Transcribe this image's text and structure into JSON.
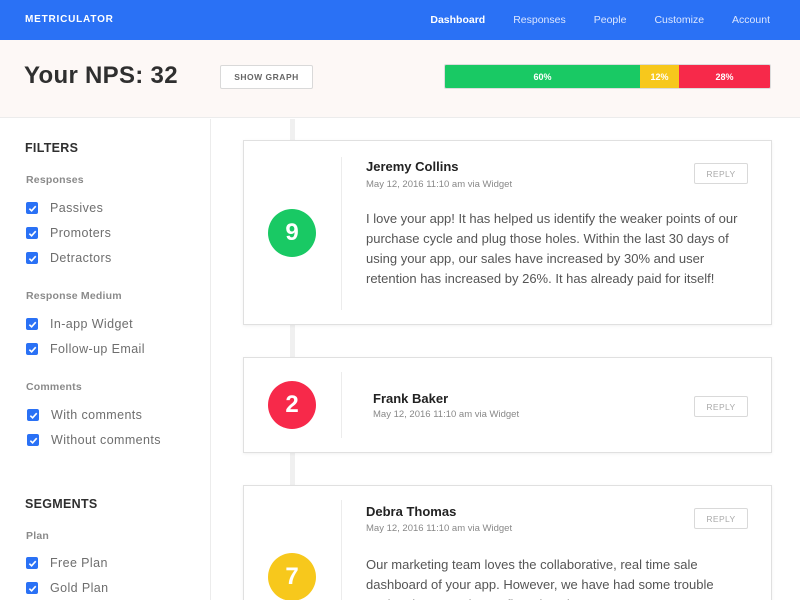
{
  "app": {
    "brand": "METRICULATOR"
  },
  "nav": {
    "items": [
      {
        "label": "Dashboard",
        "active": true
      },
      {
        "label": "Responses",
        "active": false
      },
      {
        "label": "People",
        "active": false
      },
      {
        "label": "Customize",
        "active": false
      },
      {
        "label": "Account",
        "active": false
      }
    ]
  },
  "header": {
    "title": "Your NPS: 32",
    "show_graph_label": "SHOW GRAPH",
    "breakdown": [
      {
        "label": "60%",
        "value": 60,
        "color": "#19c964"
      },
      {
        "label": "12%",
        "value": 12,
        "color": "#f7c81c"
      },
      {
        "label": "28%",
        "value": 28,
        "color": "#f7294a"
      }
    ]
  },
  "sidebar": {
    "filters_title": "FILTERS",
    "groups": [
      {
        "title": "Responses",
        "options": [
          {
            "label": "Passives",
            "checked": true
          },
          {
            "label": "Promoters",
            "checked": true
          },
          {
            "label": "Detractors",
            "checked": true
          }
        ]
      },
      {
        "title": "Response Medium",
        "options": [
          {
            "label": "In-app Widget",
            "checked": true
          },
          {
            "label": "Follow-up Email",
            "checked": true
          }
        ]
      },
      {
        "title": "Comments",
        "options": [
          {
            "label": "With comments",
            "checked": true
          },
          {
            "label": "Without comments",
            "checked": true
          }
        ]
      }
    ],
    "segments_title": "SEGMENTS",
    "segment_groups": [
      {
        "title": "Plan",
        "options": [
          {
            "label": "Free Plan",
            "checked": true
          },
          {
            "label": "Gold Plan",
            "checked": true
          }
        ]
      }
    ]
  },
  "responses": [
    {
      "score": "9",
      "color": "#19c964",
      "name": "Jeremy Collins",
      "meta": "May 12, 2016 11:10 am via Widget",
      "reply_label": "REPLY",
      "comment": "I love your app! It has helped us identify the weaker points of our purchase cycle and plug those holes. Within the last 30 days of using your app, our sales have increased by 30% and user retention has increased by 26%. It has already paid for itself!"
    },
    {
      "score": "2",
      "color": "#f7294a",
      "name": "Frank Baker",
      "meta": "May 12, 2016 11:10 am via Widget",
      "reply_label": "REPLY",
      "comment": ""
    },
    {
      "score": "7",
      "color": "#f7c81c",
      "name": "Debra Thomas",
      "meta": "May 12, 2016 11:10 am via Widget",
      "reply_label": "REPLY",
      "comment": "Our marketing team loves the collaborative, real time sale dashboard of your app. However, we have had some trouble getting the API points to fit and work..."
    }
  ]
}
